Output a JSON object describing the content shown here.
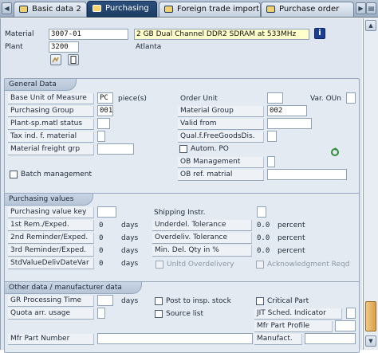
{
  "tabs": [
    {
      "label": "Basic data 2"
    },
    {
      "label": "Purchasing"
    },
    {
      "label": "Foreign trade import"
    },
    {
      "label": "Purchase order"
    }
  ],
  "header": {
    "material_label": "Material",
    "material_value": "3007-01",
    "material_desc": "2 GB Dual Channel DDR2 SDRAM at 533MHz",
    "plant_label": "Plant",
    "plant_value": "3200",
    "plant_name": "Atlanta"
  },
  "general": {
    "title": "General Data",
    "base_uom_label": "Base Unit of Measure",
    "base_uom_value": "PC",
    "base_uom_text": "piece(s)",
    "order_unit_label": "Order Unit",
    "var_oun_label": "Var. OUn",
    "purch_group_label": "Purchasing Group",
    "purch_group_value": "001",
    "material_group_label": "Material Group",
    "material_group_value": "002",
    "plant_sp_status_label": "Plant-sp.matl status",
    "valid_from_label": "Valid from",
    "tax_ind_label": "Tax ind. f. material",
    "qual_free_goods_label": "Qual.f.FreeGoodsDis.",
    "freight_grp_label": "Material freight grp",
    "autom_po_label": "Autom. PO",
    "ob_management_label": "OB Management",
    "batch_mgmt_label": "Batch management",
    "ob_ref_label": "OB ref. matrial"
  },
  "purchasing": {
    "title": "Purchasing values",
    "value_key_label": "Purchasing value key",
    "shipping_instr_label": "Shipping Instr.",
    "rem1_label": "1st Rem./Exped.",
    "rem1_value": "0",
    "rem2_label": "2nd Reminder/Exped.",
    "rem2_value": "0",
    "rem3_label": "3rd Reminder/Exped.",
    "rem3_value": "0",
    "std_val_label": "StdValueDelivDateVar",
    "std_val_value": "0",
    "days": "days",
    "underdel_label": "Underdel. Tolerance",
    "underdel_value": "0.0",
    "overdel_label": "Overdeliv. Tolerance",
    "overdel_value": "0.0",
    "min_del_label": "Min. Del. Qty in %",
    "min_del_value": "0.0",
    "percent": "percent",
    "unltd_label": "Unltd Overdelivery",
    "ack_label": "Acknowledgment Reqd"
  },
  "other": {
    "title": "Other data / manufacturer data",
    "gr_time_label": "GR Processing Time",
    "gr_days": "days",
    "post_insp_label": "Post to insp. stock",
    "critical_part_label": "Critical Part",
    "quota_label": "Quota arr. usage",
    "source_list_label": "Source list",
    "jit_label": "JIT Sched. Indicator",
    "mfr_profile_label": "Mfr Part Profile",
    "mfr_part_no_label": "Mfr Part Number",
    "manufact_label": "Manufact."
  },
  "colors": {
    "active_tab": "#1c3a60",
    "panel_bg": "#dfe6ef",
    "desc_field": "#ffffcc",
    "scroll_thumb": "#d9a048"
  }
}
